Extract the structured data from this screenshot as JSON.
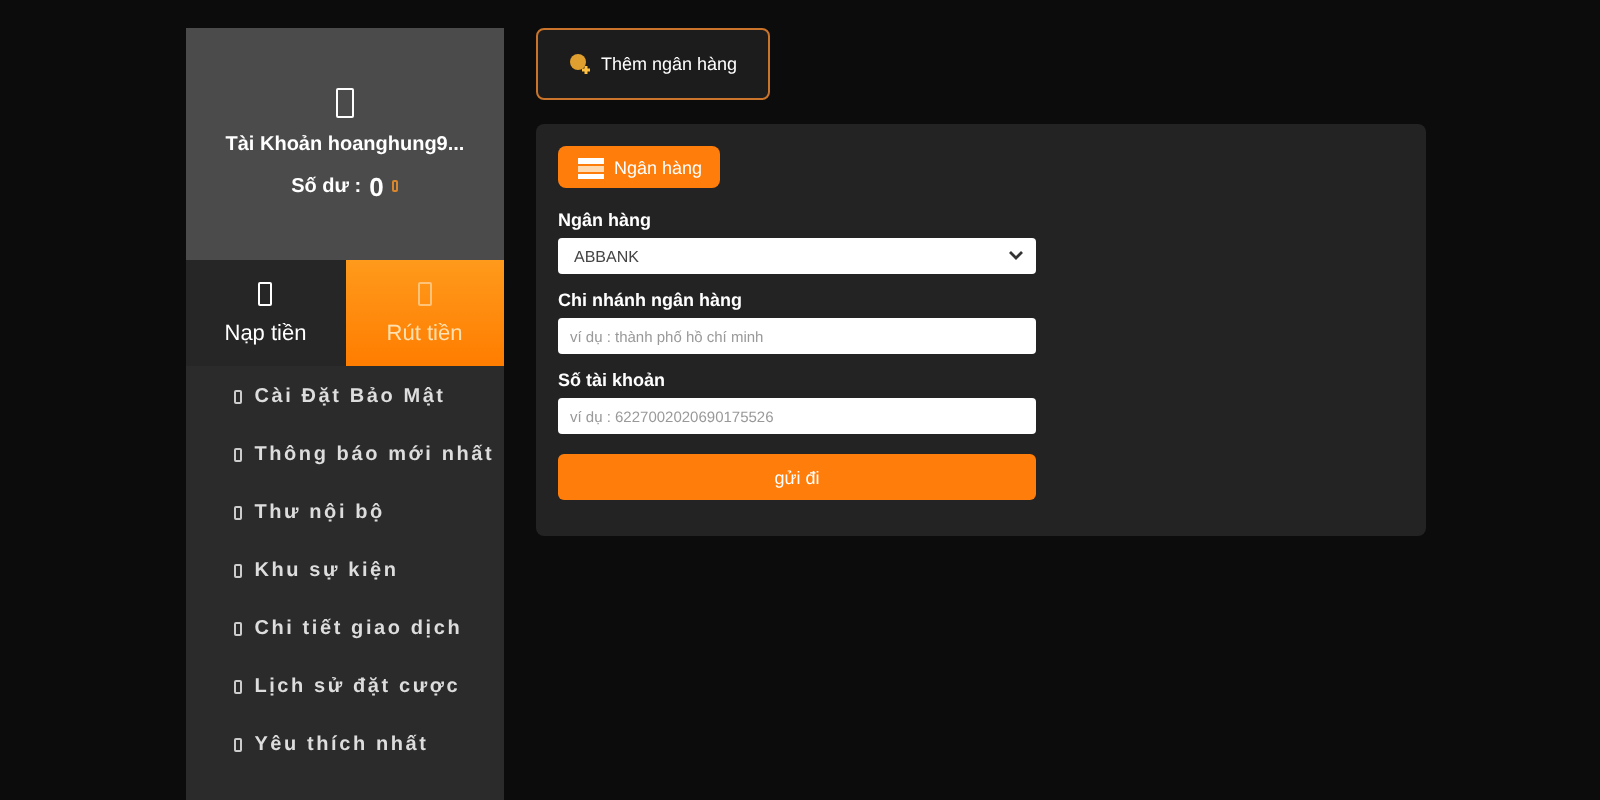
{
  "account": {
    "name": "Tài Khoản hoanghung9...",
    "balance_label": "Số dư :",
    "balance": "0"
  },
  "tabs": [
    {
      "label": "Nạp tiền",
      "selected": false
    },
    {
      "label": "Rút tiền",
      "selected": true
    }
  ],
  "menu": [
    "Cài Đặt Bảo Mật",
    "Thông báo mới nhất",
    "Thư nội bộ",
    "Khu sự kiện",
    "Chi tiết giao dịch",
    "Lịch sử đặt cược",
    "Yêu thích nhất"
  ],
  "add_bank_button": "Thêm ngân hàng",
  "panel_tab": "Ngân hàng",
  "fields": [
    {
      "kind": "select",
      "label": "Ngân hàng",
      "value": "ABBANK"
    },
    {
      "kind": "text",
      "label": "Chi nhánh ngân hàng",
      "placeholder": "ví dụ : thành phố hồ chí minh"
    },
    {
      "kind": "text",
      "label": "Số tài khoản",
      "placeholder": "ví dụ : 6227002020690175526"
    }
  ],
  "submit": "gửi đi"
}
